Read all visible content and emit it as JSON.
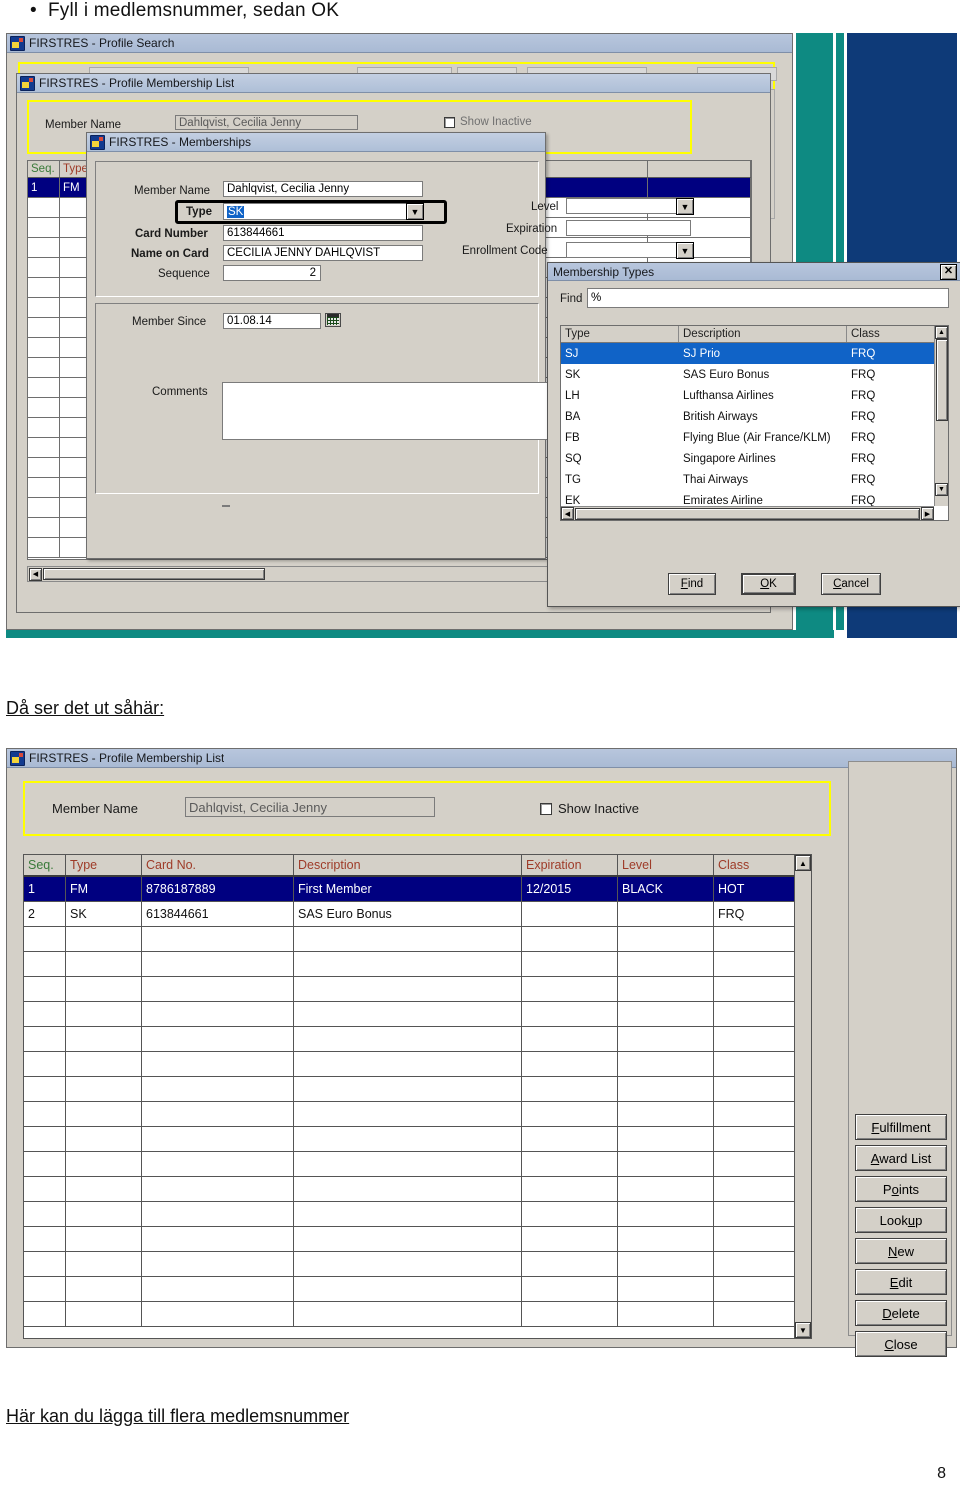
{
  "document": {
    "bullet_text": "Fyll i medlemsnummer, sedan OK",
    "heading2": "Då ser det ut såhär:",
    "footer_text": "Här kan du lägga till flera medlemsnummer",
    "page_number": "8"
  },
  "colors": {
    "titlebar": "#b0c0d8",
    "selection_blue": "#1063c7",
    "row_select_navy": "#000080",
    "highlight_yellow": "#ffff00",
    "teal_stripe": "#0e8a82",
    "navy_stripe": "#0e3a78",
    "header_red": "#9e3b28",
    "header_green": "#3a7a3a",
    "window_face": "#d4d0c8"
  },
  "screenshot1": {
    "profile_search": {
      "title": "FIRSTRES - Profile Search"
    },
    "membership_list": {
      "title": "FIRSTRES - Profile Membership List",
      "member_name_label": "Member Name",
      "member_name_value": "Dahlqvist, Cecilia Jenny",
      "show_inactive_label": "Show Inactive",
      "show_inactive_checked": false,
      "grid_headers": [
        "Seq.",
        "Type"
      ],
      "grid_rows": [
        [
          "1",
          "FM"
        ]
      ]
    },
    "memberships": {
      "title": "FIRSTRES - Memberships",
      "fields": {
        "member_name_label": "Member Name",
        "member_name_value": "Dahlqvist, Cecilia Jenny",
        "type_label": "Type",
        "type_value": "SK",
        "card_number_label": "Card Number",
        "card_number_value": "613844661",
        "name_on_card_label": "Name on Card",
        "name_on_card_value": "CECILIA JENNY DAHLQVIST",
        "sequence_label": "Sequence",
        "sequence_value": "2",
        "level_label": "Level",
        "level_value": "",
        "expiration_label": "Expiration",
        "expiration_value": "",
        "enrollment_code_label": "Enrollment Code",
        "enrollment_code_value": "",
        "member_since_label": "Member Since",
        "member_since_value": "01.08.14",
        "comments_label": "Comments",
        "comments_value": ""
      }
    },
    "membership_types": {
      "title": "Membership Types",
      "close_glyph": "✕",
      "find_label": "Find",
      "find_value": "%",
      "columns": [
        "Type",
        "Description",
        "Class"
      ],
      "rows": [
        {
          "type": "SJ",
          "description": "SJ Prio",
          "class": "FRQ",
          "selected": true
        },
        {
          "type": "SK",
          "description": "SAS Euro Bonus",
          "class": "FRQ",
          "selected": false
        },
        {
          "type": "LH",
          "description": "Lufthansa Airlines",
          "class": "FRQ",
          "selected": false
        },
        {
          "type": "BA",
          "description": "British Airways",
          "class": "FRQ",
          "selected": false
        },
        {
          "type": "FB",
          "description": "Flying Blue (Air France/KLM)",
          "class": "FRQ",
          "selected": false
        },
        {
          "type": "SQ",
          "description": "Singapore Airlines",
          "class": "FRQ",
          "selected": false
        },
        {
          "type": "TG",
          "description": "Thai Airways",
          "class": "FRQ",
          "selected": false
        },
        {
          "type": "EK",
          "description": "Emirates Airline",
          "class": "FRQ",
          "selected": false
        }
      ],
      "buttons": {
        "find": "Find",
        "ok": "OK",
        "cancel": "Cancel"
      }
    }
  },
  "screenshot2": {
    "title": "FIRSTRES - Profile Membership List",
    "member_name_label": "Member Name",
    "member_name_value": "Dahlqvist, Cecilia Jenny",
    "show_inactive_label": "Show Inactive",
    "show_inactive_checked": false,
    "columns": [
      "Seq.",
      "Type",
      "Card No.",
      "Description",
      "Expiration",
      "Level",
      "Class"
    ],
    "rows": [
      {
        "seq": "1",
        "type": "FM",
        "card_no": "8786187889",
        "description": "First Member",
        "expiration": "12/2015",
        "level": "BLACK",
        "class": "HOT",
        "selected": true
      },
      {
        "seq": "2",
        "type": "SK",
        "card_no": "613844661",
        "description": "SAS Euro Bonus",
        "expiration": "",
        "level": "",
        "class": "FRQ",
        "selected": false
      }
    ],
    "empty_row_count": 16,
    "buttons": [
      "Fulfillment",
      "Award List",
      "Points",
      "Lookup",
      "New",
      "Edit",
      "Delete",
      "Close"
    ],
    "button_accels": [
      "F",
      "A",
      "o",
      "u",
      "N",
      "E",
      "D",
      "C"
    ],
    "scroll_up_glyph": "▲",
    "scroll_down_glyph": "▼"
  }
}
